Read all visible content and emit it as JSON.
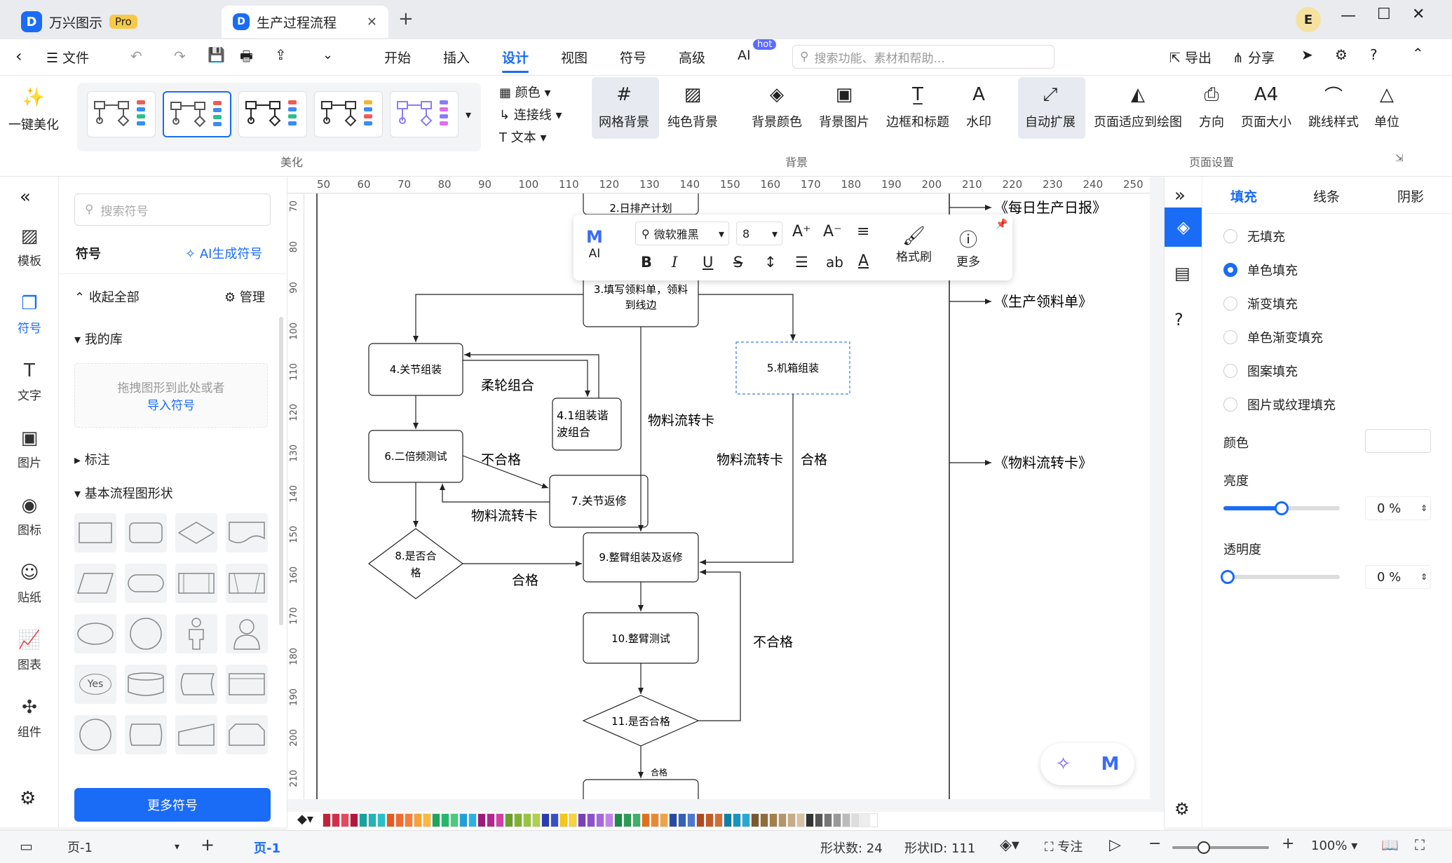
{
  "titlebar": {
    "app_name": "万兴图示",
    "pro_badge": "Pro",
    "doc_tab": "生产过程流程",
    "avatar_letter": "E"
  },
  "menubar": {
    "file": "文件",
    "tabs": [
      "开始",
      "插入",
      "设计",
      "视图",
      "符号",
      "高级",
      "AI"
    ],
    "active_tab": "设计",
    "ai_badge": "hot",
    "search_placeholder": "搜索功能、素材和帮助...",
    "export": "导出",
    "share": "分享"
  },
  "ribbon": {
    "beautify": "一键美化",
    "color": "颜色",
    "connector": "连接线",
    "text": "文本",
    "group_beautify": "美化",
    "grid_bg": "网格背景",
    "solid_bg": "纯色背景",
    "bg_color": "背景颜色",
    "bg_image": "背景图片",
    "border_title": "边框和标题",
    "watermark": "水印",
    "group_background": "背景",
    "auto_expand": "自动扩展",
    "fit_page": "页面适应到绘图",
    "orientation": "方向",
    "page_size": "页面大小",
    "jump_style": "跳线样式",
    "unit": "单位",
    "group_page_setup": "页面设置"
  },
  "leftbar": {
    "items": [
      "模板",
      "符号",
      "文字",
      "图片",
      "图标",
      "贴纸",
      "图表",
      "组件"
    ],
    "active": "符号"
  },
  "sympanel": {
    "search_placeholder": "搜索符号",
    "title": "符号",
    "ai_generate": "AI生成符号",
    "collapse_all": "收起全部",
    "manage": "管理",
    "my_library": "我的库",
    "drop_hint": "拖拽图形到此处或者",
    "import_link": "导入符号",
    "annotation": "标注",
    "basic_flow": "基本流程图形状",
    "yes_label": "Yes",
    "more_symbols": "更多符号"
  },
  "ruler": {
    "top": [
      "50",
      "60",
      "70",
      "80",
      "90",
      "100",
      "110",
      "120",
      "130",
      "140",
      "150",
      "160",
      "170",
      "180",
      "190",
      "200",
      "210",
      "220",
      "230",
      "240",
      "250"
    ],
    "left": [
      "70",
      "80",
      "90",
      "100",
      "110",
      "120",
      "130",
      "140",
      "150",
      "160",
      "170",
      "180",
      "190",
      "200",
      "210"
    ]
  },
  "float_toolbar": {
    "ai": "AI",
    "font": "微软雅黑",
    "size": "8",
    "format_painter": "格式刷",
    "more": "更多"
  },
  "diagram": {
    "n2": "2.日排产计划",
    "n3a": "3.填写领料单，领料",
    "n3b": "到线边",
    "n4": "4.关节组装",
    "n41a": "4.1组装谐",
    "n41b": "波组合",
    "n5": "5.机箱组装",
    "n6": "6.二倍频测试",
    "n7": "7.关节返修",
    "n8a": "8.是否合",
    "n8b": "格",
    "n9": "9.整臂组装及返修",
    "n10": "10.整臂测试",
    "n11": "11.是否合格",
    "l_rouzhuan": "柔轮组合",
    "l_buhege1": "不合格",
    "l_liuzhuan1": "物料流转卡",
    "l_liuzhuan2": "物料流转卡",
    "l_liuzhuan3": "物料流转卡",
    "l_hege1": "合格",
    "l_hege2": "合格",
    "l_buhege2": "不合格",
    "l_hege_small": "合格",
    "doc1": "《每日生产日报》",
    "doc2": "《生产领料单》",
    "doc3": "《物料流转卡》"
  },
  "propanel": {
    "tabs": [
      "填充",
      "线条",
      "阴影"
    ],
    "active_tab": "填充",
    "options": [
      "无填充",
      "单色填充",
      "渐变填充",
      "单色渐变填充",
      "图案填充",
      "图片或纹理填充"
    ],
    "selected_option": "单色填充",
    "color_label": "颜色",
    "brightness_label": "亮度",
    "brightness_value": "0 %",
    "opacity_label": "透明度",
    "opacity_value": "0 %",
    "brightness_level": 0.5,
    "opacity_level": 0.0
  },
  "statusbar": {
    "page_select": "页-1",
    "page_tab": "页-1",
    "shape_count": "形状数: 24",
    "shape_id": "形状ID: 111",
    "focus": "专注",
    "zoom": "100%"
  },
  "palette": [
    "#c0223a",
    "#d2304a",
    "#e44a5f",
    "#b5163d",
    "#17a2a0",
    "#22b3b8",
    "#28c0c8",
    "#e85a20",
    "#f06c2d",
    "#f47e3a",
    "#f8a134",
    "#fbb83f",
    "#1ea65a",
    "#24b86a",
    "#4cc97e",
    "#1fa1d8",
    "#2bb2e8",
    "#9b1b7a",
    "#b0268f",
    "#d23fa7",
    "#6b9e2a",
    "#80b330",
    "#97c53c",
    "#aed04a",
    "#2a3cb0",
    "#3751c8",
    "#f5c518",
    "#f8d33a",
    "#7a3eb8",
    "#8d4fcc",
    "#a566de",
    "#c183e8",
    "#1e8a4a",
    "#2a9c58",
    "#3eb06a",
    "#e0701c",
    "#e88a30",
    "#f0a248",
    "#284a9e",
    "#3360b8",
    "#4b78d0",
    "#b04a1e",
    "#c45a28",
    "#d46e36",
    "#0f7ea8",
    "#1894c0",
    "#24aad4",
    "#7a5a30",
    "#8e6c3c",
    "#a2804a",
    "#b4946a",
    "#c8aa84",
    "#d8c2a4",
    "#333333",
    "#555555",
    "#777777",
    "#999999",
    "#bbbbbb",
    "#dddddd",
    "#eeeeee",
    "#ffffff"
  ]
}
